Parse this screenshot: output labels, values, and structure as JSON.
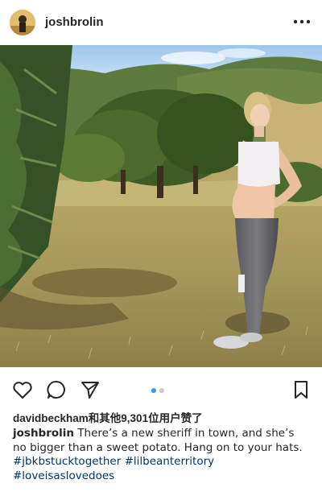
{
  "post": {
    "username": "joshbrolin",
    "more_icon": "more-horizontal-icon",
    "likes_text": "davidbeckham和其他9,301位用户赞了",
    "caption_user": "joshbrolin",
    "caption_text": "There’s a new sheriff in town, and she’s no bigger than a sweet potato. Hang on to your hats.",
    "hashtags": [
      "#jbkbstucktogether",
      "#lilbeanterritory",
      "#loveisaslovedoes"
    ],
    "carousel": {
      "count": 2,
      "active_index": 0
    },
    "colors": {
      "accent": "#3897f0",
      "hashtag": "#003569",
      "text": "#262626"
    }
  },
  "icons": {
    "like": "heart-icon",
    "comment": "comment-icon",
    "share": "send-icon",
    "save": "bookmark-icon"
  }
}
